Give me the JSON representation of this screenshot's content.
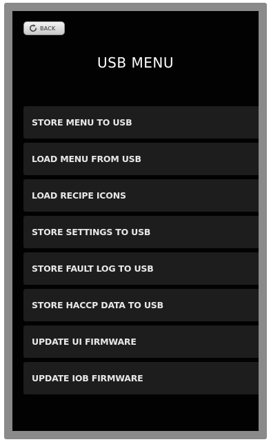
{
  "header": {
    "back_label": "BACK",
    "back_icon": "refresh-arrow-icon",
    "title": "USB MENU"
  },
  "menu": {
    "items": [
      {
        "label": "STORE MENU TO USB"
      },
      {
        "label": "LOAD MENU FROM USB"
      },
      {
        "label": "LOAD RECIPE ICONS"
      },
      {
        "label": "STORE SETTINGS TO USB"
      },
      {
        "label": "STORE FAULT LOG TO USB"
      },
      {
        "label": "STORE HACCP DATA TO USB"
      },
      {
        "label": "UPDATE UI FIRMWARE"
      },
      {
        "label": "UPDATE IOB FIRMWARE"
      }
    ]
  },
  "colors": {
    "screen_background": "#020202",
    "device_frame": "#8a8a8a",
    "button_background": "#1d1d1d",
    "text": "#e8e8e8"
  }
}
